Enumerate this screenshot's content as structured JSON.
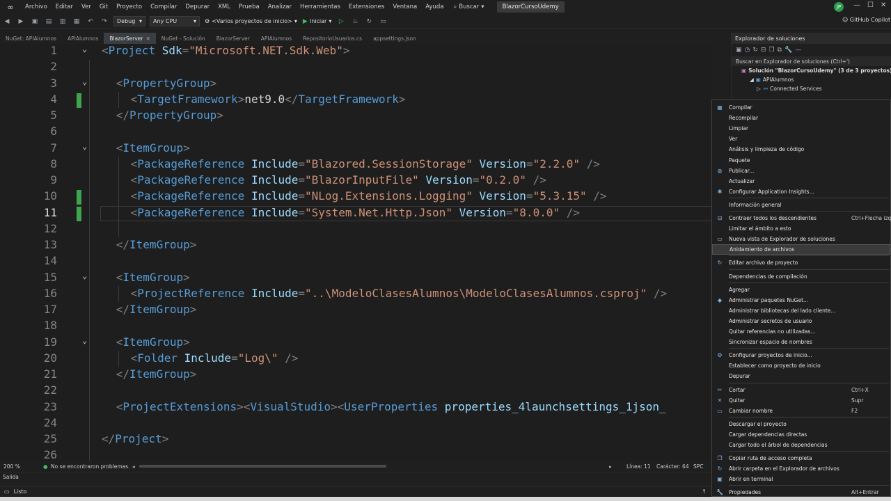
{
  "menubar": {
    "items": [
      "Archivo",
      "Editar",
      "Ver",
      "Git",
      "Proyecto",
      "Compilar",
      "Depurar",
      "XML",
      "Prueba",
      "Analizar",
      "Herramientas",
      "Extensiones",
      "Ventana",
      "Ayuda"
    ],
    "search_label": "Buscar",
    "solution_name": "BlazorCursoUdemy",
    "avatar_initials": "JP"
  },
  "toolbar": {
    "config": "Debug",
    "platform": "Any CPU",
    "startup": "<Varios proyectos de inicio>",
    "run_label": "Iniciar",
    "copilot_label": "GitHub Copilot"
  },
  "tabs": [
    {
      "label": "NuGet: APIAlumnos",
      "active": false
    },
    {
      "label": "APIAlumnos",
      "active": false
    },
    {
      "label": "BlazorServer",
      "active": true
    },
    {
      "label": "NuGet - Solución",
      "active": false
    },
    {
      "label": "BlazorServer",
      "active": false
    },
    {
      "label": "APIAlumnos",
      "active": false
    },
    {
      "label": "RepositorioUsuarios.cs",
      "active": false
    },
    {
      "label": "appsettings.json",
      "active": false
    }
  ],
  "editor": {
    "current_line": 11,
    "lines": [
      {
        "n": "1",
        "fold": true,
        "mark": false,
        "indent": 0,
        "tokens": [
          [
            "br",
            "<"
          ],
          [
            "tag",
            "Project"
          ],
          [
            "txt",
            " "
          ],
          [
            "attr",
            "Sdk"
          ],
          [
            "br",
            "="
          ],
          [
            "val",
            "\"Microsoft.NET.Sdk.Web\""
          ],
          [
            "br",
            ">"
          ]
        ]
      },
      {
        "n": "2",
        "fold": false,
        "mark": false,
        "indent": 0,
        "tokens": []
      },
      {
        "n": "3",
        "fold": true,
        "mark": false,
        "indent": 1,
        "tokens": [
          [
            "br",
            "<"
          ],
          [
            "tag",
            "PropertyGroup"
          ],
          [
            "br",
            ">"
          ]
        ]
      },
      {
        "n": "4",
        "fold": false,
        "mark": true,
        "indent": 2,
        "tokens": [
          [
            "br",
            "<"
          ],
          [
            "tag",
            "TargetFramework"
          ],
          [
            "br",
            ">"
          ],
          [
            "txt",
            "net9.0"
          ],
          [
            "br",
            "</"
          ],
          [
            "tag",
            "TargetFramework"
          ],
          [
            "br",
            ">"
          ]
        ]
      },
      {
        "n": "5",
        "fold": false,
        "mark": false,
        "indent": 1,
        "tokens": [
          [
            "br",
            "</"
          ],
          [
            "tag",
            "PropertyGroup"
          ],
          [
            "br",
            ">"
          ]
        ]
      },
      {
        "n": "6",
        "fold": false,
        "mark": false,
        "indent": 0,
        "tokens": []
      },
      {
        "n": "7",
        "fold": true,
        "mark": false,
        "indent": 1,
        "tokens": [
          [
            "br",
            "<"
          ],
          [
            "tag",
            "ItemGroup"
          ],
          [
            "br",
            ">"
          ]
        ]
      },
      {
        "n": "8",
        "fold": false,
        "mark": false,
        "indent": 2,
        "tokens": [
          [
            "br",
            "<"
          ],
          [
            "tag",
            "PackageReference"
          ],
          [
            "txt",
            " "
          ],
          [
            "attr",
            "Include"
          ],
          [
            "br",
            "="
          ],
          [
            "val",
            "\"Blazored.SessionStorage\""
          ],
          [
            "txt",
            " "
          ],
          [
            "attr",
            "Version"
          ],
          [
            "br",
            "="
          ],
          [
            "val",
            "\"2.2.0\""
          ],
          [
            "txt",
            " "
          ],
          [
            "br",
            "/>"
          ]
        ]
      },
      {
        "n": "9",
        "fold": false,
        "mark": false,
        "indent": 2,
        "tokens": [
          [
            "br",
            "<"
          ],
          [
            "tag",
            "PackageReference"
          ],
          [
            "txt",
            " "
          ],
          [
            "attr",
            "Include"
          ],
          [
            "br",
            "="
          ],
          [
            "val",
            "\"BlazorInputFile\""
          ],
          [
            "txt",
            " "
          ],
          [
            "attr",
            "Version"
          ],
          [
            "br",
            "="
          ],
          [
            "val",
            "\"0.2.0\""
          ],
          [
            "txt",
            " "
          ],
          [
            "br",
            "/>"
          ]
        ]
      },
      {
        "n": "10",
        "fold": false,
        "mark": true,
        "indent": 2,
        "tokens": [
          [
            "br",
            "<"
          ],
          [
            "tag",
            "PackageReference"
          ],
          [
            "txt",
            " "
          ],
          [
            "attr",
            "Include"
          ],
          [
            "br",
            "="
          ],
          [
            "val",
            "\"NLog.Extensions.Logging\""
          ],
          [
            "txt",
            " "
          ],
          [
            "attr",
            "Version"
          ],
          [
            "br",
            "="
          ],
          [
            "val",
            "\"5.3.15\""
          ],
          [
            "txt",
            " "
          ],
          [
            "br",
            "/>"
          ]
        ]
      },
      {
        "n": "11",
        "fold": false,
        "mark": true,
        "indent": 2,
        "tokens": [
          [
            "br",
            "<"
          ],
          [
            "tag",
            "PackageReference"
          ],
          [
            "txt",
            " "
          ],
          [
            "attr",
            "Include"
          ],
          [
            "br",
            "="
          ],
          [
            "val",
            "\"System.Net.Http.Json\""
          ],
          [
            "txt",
            " "
          ],
          [
            "attr",
            "Version"
          ],
          [
            "br",
            "="
          ],
          [
            "val",
            "\"8.0.0\""
          ],
          [
            "txt",
            " "
          ],
          [
            "br",
            "/>"
          ]
        ]
      },
      {
        "n": "12",
        "fold": false,
        "mark": false,
        "indent": 0,
        "tokens": []
      },
      {
        "n": "13",
        "fold": false,
        "mark": false,
        "indent": 1,
        "tokens": [
          [
            "br",
            "</"
          ],
          [
            "tag",
            "ItemGroup"
          ],
          [
            "br",
            ">"
          ]
        ]
      },
      {
        "n": "14",
        "fold": false,
        "mark": false,
        "indent": 0,
        "tokens": []
      },
      {
        "n": "15",
        "fold": true,
        "mark": false,
        "indent": 1,
        "tokens": [
          [
            "br",
            "<"
          ],
          [
            "tag",
            "ItemGroup"
          ],
          [
            "br",
            ">"
          ]
        ]
      },
      {
        "n": "16",
        "fold": false,
        "mark": false,
        "indent": 2,
        "tokens": [
          [
            "br",
            "<"
          ],
          [
            "tag",
            "ProjectReference"
          ],
          [
            "txt",
            " "
          ],
          [
            "attr",
            "Include"
          ],
          [
            "br",
            "="
          ],
          [
            "val",
            "\"..\\ModeloClasesAlumnos\\ModeloClasesAlumnos.csproj\""
          ],
          [
            "txt",
            " "
          ],
          [
            "br",
            "/>"
          ]
        ]
      },
      {
        "n": "17",
        "fold": false,
        "mark": false,
        "indent": 1,
        "tokens": [
          [
            "br",
            "</"
          ],
          [
            "tag",
            "ItemGroup"
          ],
          [
            "br",
            ">"
          ]
        ]
      },
      {
        "n": "18",
        "fold": false,
        "mark": false,
        "indent": 0,
        "tokens": []
      },
      {
        "n": "19",
        "fold": true,
        "mark": false,
        "indent": 1,
        "tokens": [
          [
            "br",
            "<"
          ],
          [
            "tag",
            "ItemGroup"
          ],
          [
            "br",
            ">"
          ]
        ]
      },
      {
        "n": "20",
        "fold": false,
        "mark": false,
        "indent": 2,
        "tokens": [
          [
            "br",
            "<"
          ],
          [
            "tag",
            "Folder"
          ],
          [
            "txt",
            " "
          ],
          [
            "attr",
            "Include"
          ],
          [
            "br",
            "="
          ],
          [
            "val",
            "\"Log\\\""
          ],
          [
            "txt",
            " "
          ],
          [
            "br",
            "/>"
          ]
        ]
      },
      {
        "n": "21",
        "fold": false,
        "mark": false,
        "indent": 1,
        "tokens": [
          [
            "br",
            "</"
          ],
          [
            "tag",
            "ItemGroup"
          ],
          [
            "br",
            ">"
          ]
        ]
      },
      {
        "n": "22",
        "fold": false,
        "mark": false,
        "indent": 0,
        "tokens": []
      },
      {
        "n": "23",
        "fold": false,
        "mark": false,
        "indent": 1,
        "tokens": [
          [
            "br",
            "<"
          ],
          [
            "tag",
            "ProjectExtensions"
          ],
          [
            "br",
            "><"
          ],
          [
            "tag",
            "VisualStudio"
          ],
          [
            "br",
            "><"
          ],
          [
            "tag",
            "UserProperties"
          ],
          [
            "txt",
            " "
          ],
          [
            "attr",
            "properties_4launchsettings_1json_"
          ]
        ]
      },
      {
        "n": "24",
        "fold": false,
        "mark": false,
        "indent": 0,
        "tokens": []
      },
      {
        "n": "25",
        "fold": false,
        "mark": false,
        "indent": 0,
        "tokens": [
          [
            "br",
            "</"
          ],
          [
            "tag",
            "Project"
          ],
          [
            "br",
            ">"
          ]
        ]
      },
      {
        "n": "26",
        "fold": false,
        "mark": false,
        "indent": 0,
        "tokens": []
      }
    ]
  },
  "editor_status": {
    "zoom": "200 %",
    "problems": "No se encontraron problemas.",
    "line": "Línea: 11",
    "char": "Carácter: 64",
    "spc": "SPC"
  },
  "output_label": "Salida",
  "status": {
    "text": "Listo"
  },
  "solution_explorer": {
    "title": "Explorador de soluciones",
    "search": "Buscar en Explorador de soluciones (Ctrl+')",
    "solution": "Solución \"BlazorCursoUdemy\" (3 de 3 proyectos)",
    "project": "APIAlumnos",
    "child": "Connected Services"
  },
  "context_menu": [
    {
      "label": "Compilar",
      "icon": "build-icon",
      "glyph": "▦"
    },
    {
      "label": "Recompilar"
    },
    {
      "label": "Limpiar"
    },
    {
      "label": "Ver"
    },
    {
      "label": "Análisis y limpieza de código"
    },
    {
      "label": "Paquete"
    },
    {
      "label": "Publicar...",
      "icon": "globe-icon",
      "glyph": "◍"
    },
    {
      "label": "Actualizar"
    },
    {
      "label": "Configurar Application Insights...",
      "icon": "insights-icon",
      "glyph": "✱"
    },
    {
      "sep": true
    },
    {
      "label": "Información general"
    },
    {
      "sep": true
    },
    {
      "label": "Contraer todos los descendientes",
      "shortcut": "Ctrl+Flecha izqu",
      "icon": "collapse-icon",
      "glyph": "⊟"
    },
    {
      "label": "Limitar el ámbito a esto"
    },
    {
      "label": "Nueva vista de Explorador de soluciones",
      "icon": "new-view-icon",
      "glyph": "▭"
    },
    {
      "label": "Anidamiento de archivos",
      "highlight": true
    },
    {
      "sep": true
    },
    {
      "label": "Editar archivo de proyecto",
      "icon": "refresh-icon",
      "glyph": "↻"
    },
    {
      "sep": true
    },
    {
      "label": "Dependencias de compilación"
    },
    {
      "sep": true
    },
    {
      "label": "Agregar"
    },
    {
      "label": "Administrar paquetes NuGet...",
      "icon": "nuget-icon",
      "glyph": "◆"
    },
    {
      "label": "Administrar bibliotecas del lado cliente..."
    },
    {
      "label": "Administrar secretos de usuario"
    },
    {
      "label": "Quitar referencias no utilizadas..."
    },
    {
      "label": "Sincronizar espacio de nombres"
    },
    {
      "sep": true
    },
    {
      "label": "Configurar proyectos de inicio...",
      "icon": "gear-icon",
      "glyph": "⚙"
    },
    {
      "label": "Establecer como proyecto de inicio"
    },
    {
      "label": "Depurar"
    },
    {
      "sep": true
    },
    {
      "label": "Cortar",
      "shortcut": "Ctrl+X",
      "icon": "scissors-icon",
      "glyph": "✂"
    },
    {
      "label": "Quitar",
      "shortcut": "Supr",
      "icon": "close-icon",
      "glyph": "✕"
    },
    {
      "label": "Cambiar nombre",
      "shortcut": "F2",
      "icon": "rename-icon",
      "glyph": "▭"
    },
    {
      "sep": true
    },
    {
      "label": "Descargar el proyecto"
    },
    {
      "label": "Cargar dependencias directas"
    },
    {
      "label": "Cargar todo el árbol de dependencias"
    },
    {
      "sep": true
    },
    {
      "label": "Copiar ruta de acceso completa",
      "icon": "copy-icon",
      "glyph": "❐"
    },
    {
      "label": "Abrir carpeta en el Explorador de archivos",
      "icon": "refresh-icon",
      "glyph": "↻"
    },
    {
      "label": "Abrir en terminal",
      "icon": "terminal-icon",
      "glyph": "▣"
    },
    {
      "sep": true
    },
    {
      "label": "Propiedades",
      "shortcut": "Alt+Entrar",
      "icon": "wrench-icon",
      "glyph": "🔧"
    }
  ]
}
